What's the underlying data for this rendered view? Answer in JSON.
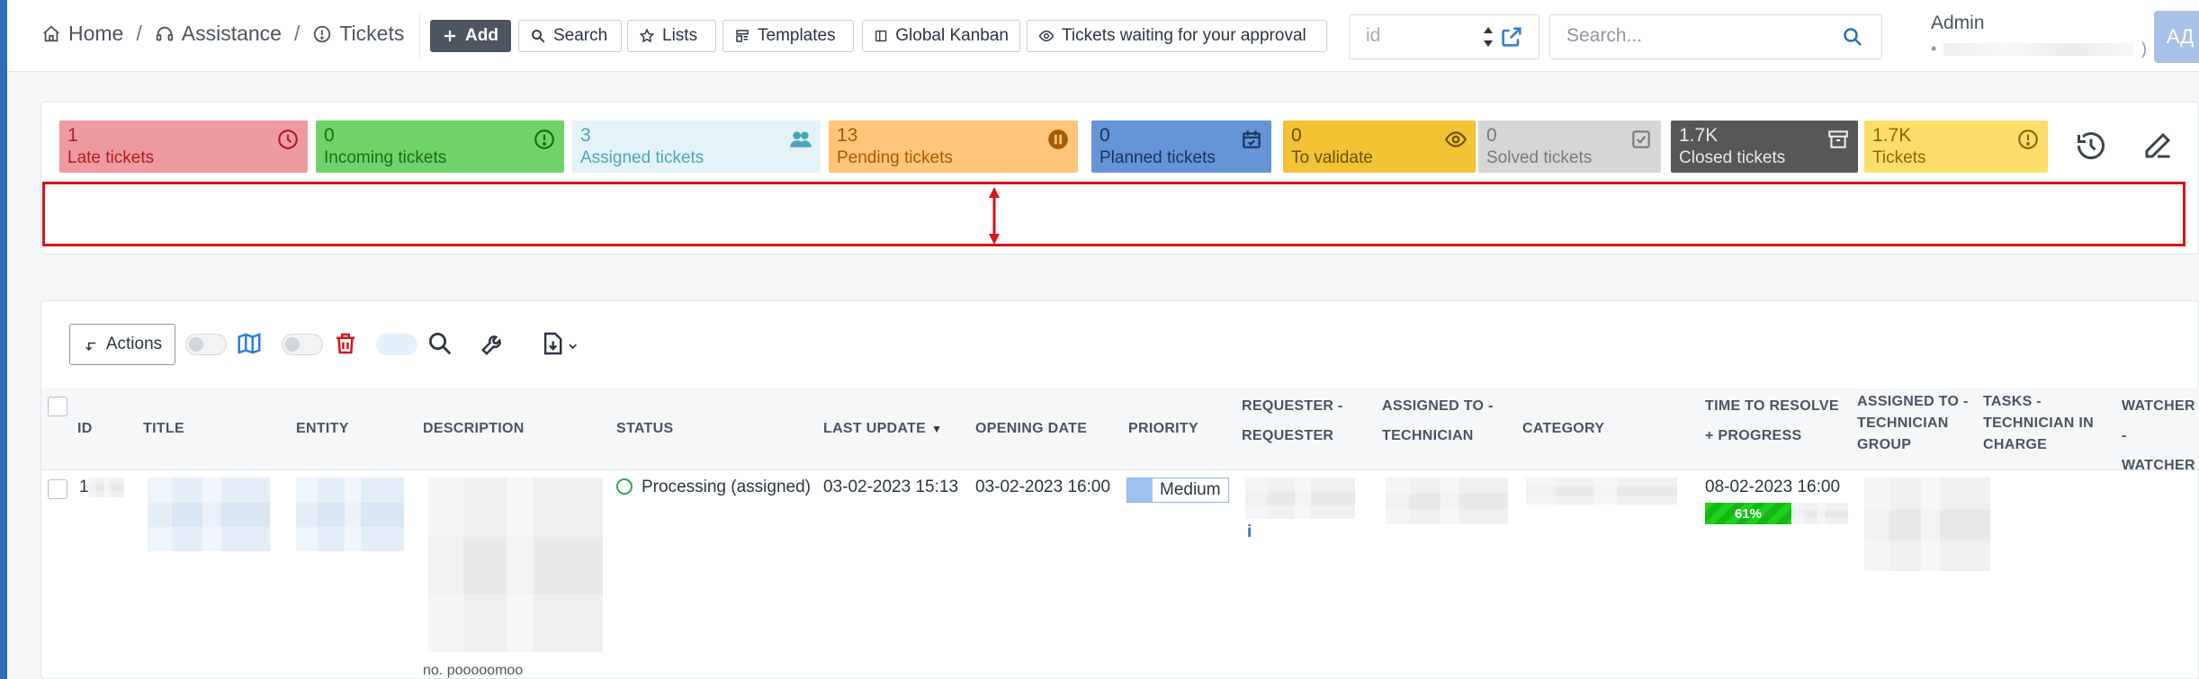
{
  "breadcrumbs": [
    {
      "label": "Home"
    },
    {
      "label": "Assistance"
    },
    {
      "label": "Tickets"
    }
  ],
  "toolbar": {
    "add": "Add",
    "search": "Search",
    "lists": "Lists",
    "templates": "Templates",
    "kanban": "Global Kanban",
    "approval": "Tickets waiting for your approval"
  },
  "id_field": {
    "placeholder": "id"
  },
  "search_field": {
    "placeholder": "Search..."
  },
  "user": {
    "name": "Admin",
    "entity_prefix": "•",
    "entity_suffix": ")",
    "initials": "АД"
  },
  "counters": [
    {
      "num": "1",
      "label": "Late tickets",
      "bg": "#ee9b9f",
      "fg": "#b11c22",
      "icon": "clock-icon"
    },
    {
      "num": "0",
      "label": "Incoming tickets",
      "bg": "#6fd36a",
      "fg": "#1d6b1d",
      "icon": "alert-circle-icon"
    },
    {
      "num": "3",
      "label": "Assigned tickets",
      "bg": "#e3f3f7",
      "fg": "#4aa6bd",
      "icon": "users-icon"
    },
    {
      "num": "13",
      "label": "Pending tickets",
      "bg": "#ffc57a",
      "fg": "#a85a00",
      "icon": "pause-icon"
    },
    {
      "num": "0",
      "label": "Planned tickets",
      "bg": "#6495d6",
      "fg": "#17345c",
      "icon": "calendar-icon"
    },
    {
      "num": "0",
      "label": "To validate",
      "bg": "#f3c235",
      "fg": "#6b4f00",
      "icon": "eye-icon"
    },
    {
      "num": "0",
      "label": "Solved tickets",
      "bg": "#d6d6d6",
      "fg": "#7a7a7a",
      "icon": "check-square-icon"
    },
    {
      "num": "1.7K",
      "label": "Closed tickets",
      "bg": "#555759",
      "fg": "#e8e8e8",
      "icon": "archive-icon"
    },
    {
      "num": "1.7K",
      "label": "Tickets",
      "bg": "#fddd6b",
      "fg": "#8a6a00",
      "icon": "info-circle-icon"
    }
  ],
  "table_toolbar": {
    "actions": "Actions"
  },
  "columns": [
    {
      "label": "ID"
    },
    {
      "label": "Title"
    },
    {
      "label": "Entity"
    },
    {
      "label": "Description"
    },
    {
      "label": "Status"
    },
    {
      "label": "Last update"
    },
    {
      "label": "Opening date"
    },
    {
      "label": "Priority"
    },
    {
      "label": "Requester - Requester"
    },
    {
      "label": "Assigned to - Technician"
    },
    {
      "label": "Category"
    },
    {
      "label": "Time to resolve + Progress"
    },
    {
      "label": "Assigned to - Technician group"
    },
    {
      "label": "Tasks - Technician in charge"
    },
    {
      "label": "Watcher - Watcher"
    }
  ],
  "row": {
    "id": "1",
    "status": "Processing (assigned)",
    "last_update": "03-02-2023 15:13",
    "opening_date": "03-02-2023 16:00",
    "priority": "Medium",
    "requester_info": "i",
    "time_to_resolve": "08-02-2023 16:00",
    "progress_label": "61%",
    "progress": 61,
    "description_fragment": "no. pooooomoo"
  },
  "colors": {
    "accent": "#2f6fb5",
    "annotation": "#d6141a",
    "status_ok": "#2fa84f"
  }
}
